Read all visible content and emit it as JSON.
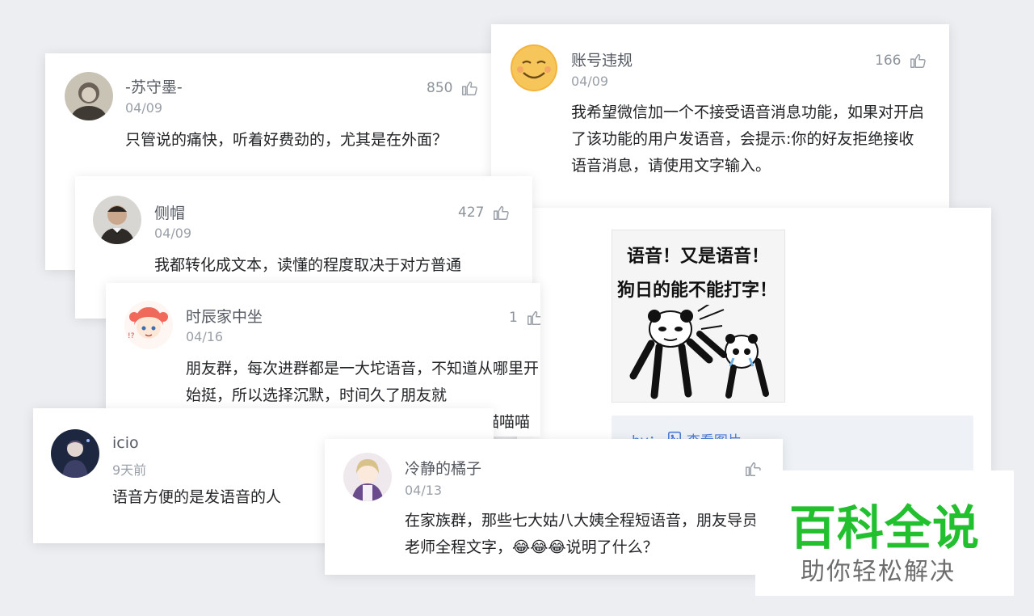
{
  "comments": [
    {
      "name": "-苏守墨-",
      "date": "04/09",
      "likes": "850",
      "text": "只管说的痛快，听着好费劲的，尤其是在外面？"
    },
    {
      "name": "账号违规",
      "date": "04/09",
      "likes": "166",
      "text": "我希望微信加一个不接受语音消息功能，如果对开启了该功能的用户发语音，会提示:你的好友拒绝接收语音消息，请使用文字输入。"
    },
    {
      "name": "侧帽",
      "date": "04/09",
      "likes": "427",
      "text": "我都转化成文本，读懂的程度取决于对方普通"
    },
    {
      "name": "时辰家中坐",
      "date": "04/16",
      "likes": "1",
      "text": "朋友群，每次进群都是一大坨语音，不知道从哪里开始挺，所以选择沉默，时间久了朋友就"
    },
    {
      "name": "icio",
      "date": "9天前",
      "likes": "",
      "text": "语音方便的是发语音的人"
    },
    {
      "name": "冷静的橘子",
      "date": "04/13",
      "likes": "",
      "text": "在家族群，那些七大姑八大姨全程短语音，朋友导员老师全程文字，😂😂😂说明了什么？"
    }
  ],
  "overflow_fragment": "喵喵喵",
  "meme": {
    "line1": "语音！又是语音！",
    "line2": "狗日的能不能打字！"
  },
  "view_image_link": "查看图片",
  "view_image_prefix": "by：",
  "brand": {
    "title": "百科全说",
    "subtitle": "助你轻松解决",
    "color": "#22c02e"
  }
}
